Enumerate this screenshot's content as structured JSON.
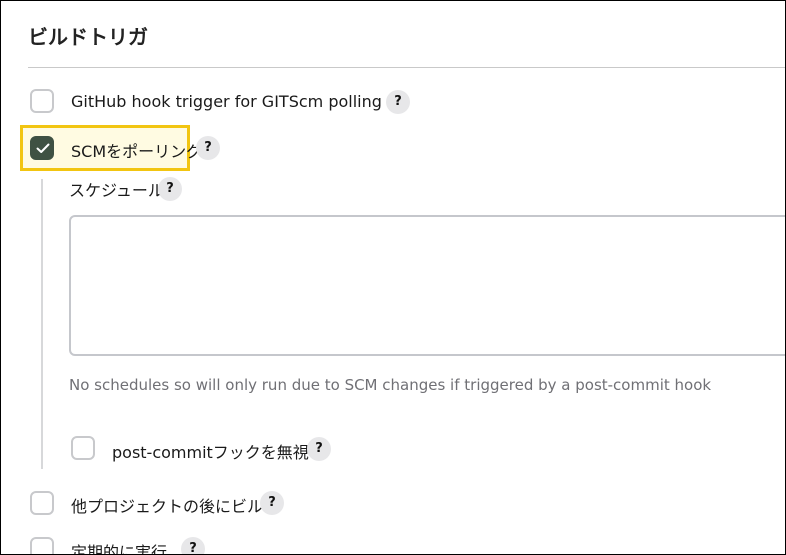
{
  "section": {
    "title": "ビルドトリガ"
  },
  "triggers": {
    "github_hook": {
      "label": "GitHub hook trigger for GITScm polling",
      "checked": false
    },
    "scm_polling": {
      "label": "SCMをポーリング",
      "checked": true,
      "schedule_label": "スケジュール",
      "schedule_value": "",
      "hint": "No schedules so will only run due to SCM changes if triggered by a post-commit hook",
      "ignore_post_commit": {
        "label": "post-commitフックを無視",
        "checked": false
      }
    },
    "after_other_projects": {
      "label": "他プロジェクトの後にビルド",
      "checked": false
    },
    "periodic": {
      "label": "定期的に実行",
      "checked": false
    }
  },
  "help_icon_text": "?",
  "colors": {
    "checked_fill": "#3f5143",
    "highlight_border": "#f2c511",
    "highlight_fill": "#fffbe2"
  }
}
